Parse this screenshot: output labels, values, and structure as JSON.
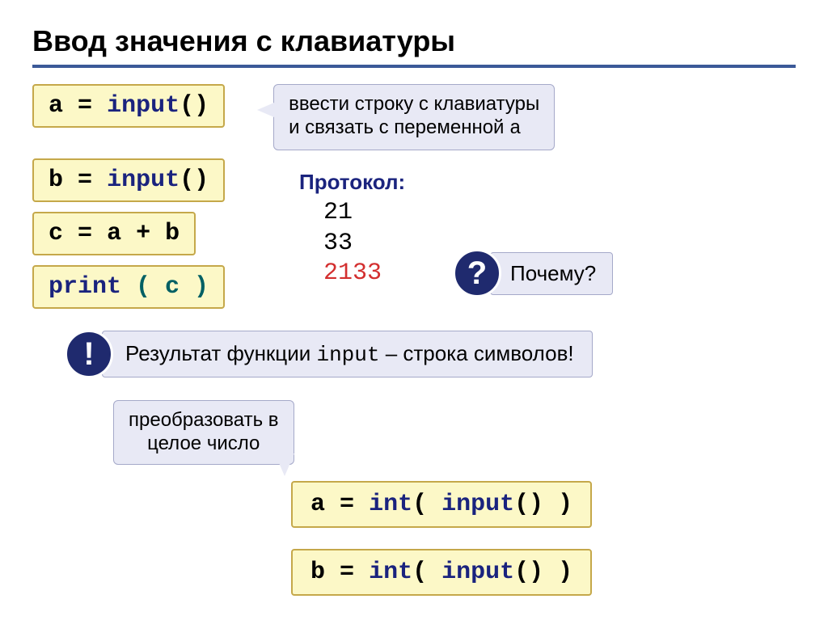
{
  "title": "Ввод значения с клавиатуры",
  "code1": {
    "a": "a",
    "eq": "=",
    "input": "input",
    "parens": "()"
  },
  "callout1_line1": "ввести строку с клавиатуры",
  "callout1_line2_a": "и связать с переменной ",
  "callout1_var": "a",
  "code2": {
    "b": "b",
    "eq": "=",
    "input": "input",
    "parens": "()"
  },
  "code3": {
    "c": "c",
    "eq": "=",
    "expr": "a + b"
  },
  "code4": {
    "print": "print",
    "args": "( c )"
  },
  "protocol": {
    "label": "Протокол:",
    "v1": "21",
    "v2": "33",
    "v3": "2133"
  },
  "why": {
    "badge": "?",
    "text": "Почему?"
  },
  "excl": {
    "badge": "!",
    "text_a": "Результат функции ",
    "text_input": "input",
    "text_b": " – строка символов!"
  },
  "convert_callout_l1": "преобразовать в",
  "convert_callout_l2": "целое число",
  "code5": {
    "a": "a",
    "eq": "=",
    "int": "int",
    "mid": "( ",
    "input": "input",
    "tail": "() )"
  },
  "code6": {
    "b": "b",
    "eq": "=",
    "int": "int",
    "mid": "( ",
    "input": "input",
    "tail": "() )"
  }
}
